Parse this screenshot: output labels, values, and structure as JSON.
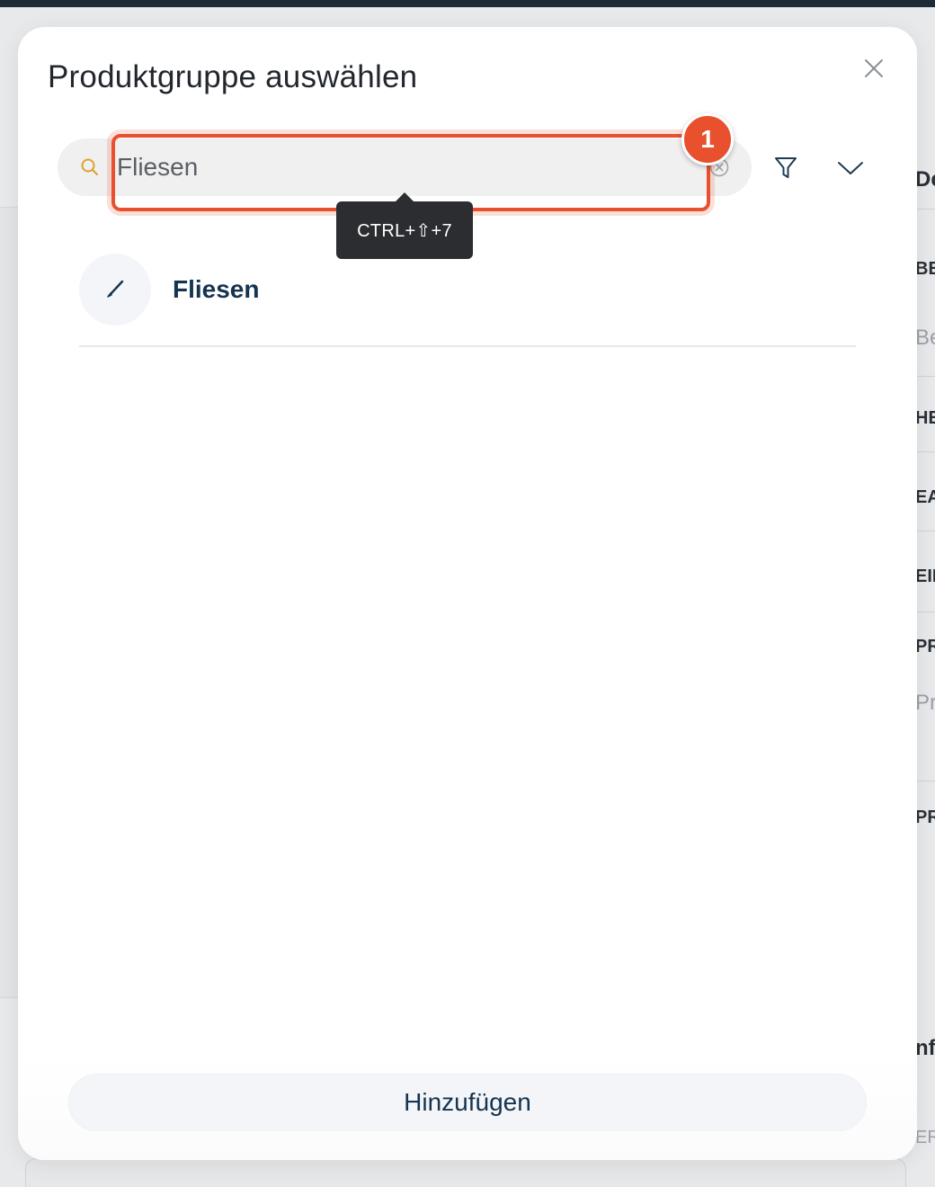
{
  "modal": {
    "title": "Produktgruppe auswählen",
    "search": {
      "value": "Fliesen",
      "placeholder": "Fliesen"
    },
    "step_badge": "1",
    "tooltip_shortcut": "CTRL+⇧+7",
    "results": [
      {
        "label": "Fliesen",
        "icon": "brush-icon"
      }
    ],
    "add_button_label": "Hinzufügen"
  },
  "background": {
    "right_labels": [
      {
        "text": "De",
        "bold": true
      },
      {
        "text": "BE",
        "bold": true
      },
      {
        "text": "Be",
        "bold": false
      },
      {
        "text": "HE",
        "bold": true
      },
      {
        "text": "EA",
        "bold": true
      },
      {
        "text": "EIN",
        "bold": true
      },
      {
        "text": "PR",
        "bold": true
      },
      {
        "text": "Pr",
        "bold": false
      },
      {
        "text": "PR",
        "bold": true
      },
      {
        "text": "nf",
        "bold": true
      },
      {
        "text": "ER",
        "bold": false
      }
    ]
  },
  "colors": {
    "accent": "#e8502e",
    "primary_text": "#16334f",
    "search_icon": "#e0a030"
  }
}
